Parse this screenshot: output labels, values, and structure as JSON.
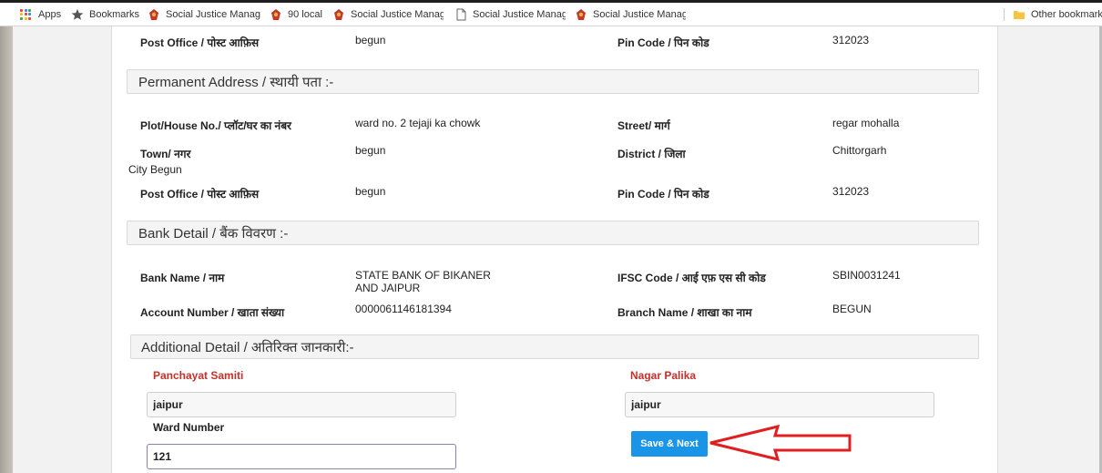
{
  "bookmarks": [
    {
      "label": "Apps",
      "icon": "apps-grid-icon"
    },
    {
      "label": "Bookmarks",
      "icon": "star-icon"
    },
    {
      "label": "Social Justice Manage",
      "icon": "emblem-icon"
    },
    {
      "label": "90 local",
      "icon": "emblem-icon"
    },
    {
      "label": "Social Justice Manage",
      "icon": "emblem-icon"
    },
    {
      "label": "Social Justice Manage",
      "icon": "page-icon"
    },
    {
      "label": "Social Justice Manage",
      "icon": "emblem-icon"
    },
    {
      "label": "Other bookmarks",
      "icon": "folder-icon"
    }
  ],
  "current_address": {
    "post_office_label": "Post Office / पोस्ट आफ़िस",
    "post_office": "begun",
    "pin_label": "Pin Code / पिन कोड",
    "pin": "312023"
  },
  "permanent_address": {
    "title": "Permanent Address / स्थायी पता :-",
    "house_label": "Plot/House No./ प्लॉट/घर का नंबर",
    "house": "ward no. 2 tejaji ka chowk",
    "street_label": "Street/ मार्ग",
    "street": "regar mohalla",
    "town_label": "Town/ नगर",
    "town": "begun",
    "district_label": "District / जिला",
    "district": "Chittorgarh",
    "city_note": "City Begun",
    "post_office_label": "Post Office / पोस्ट आफ़िस",
    "post_office": "begun",
    "pin_label": "Pin Code / पिन कोड",
    "pin": "312023"
  },
  "bank_detail": {
    "title": "Bank Detail / बैंक विवरण :-",
    "bank_name_label": "Bank Name / नाम",
    "bank_name_line1": "STATE BANK OF BIKANER",
    "bank_name_line2": "AND JAIPUR",
    "ifsc_label": "IFSC Code / आई एफ़ एस सी कोड",
    "ifsc": "SBIN0031241",
    "account_label": "Account Number / खाता संख्या",
    "account": "0000061146181394",
    "branch_label": "Branch Name / शाखा का नाम",
    "branch": "BEGUN"
  },
  "additional_detail": {
    "title": "Additional Detail / अतिरिक्त जानकारी:-",
    "panchayat_label": "Panchayat Samiti",
    "panchayat_value": "jaipur",
    "nagar_label": "Nagar Palika",
    "nagar_value": "jaipur",
    "ward_label": "Ward Number",
    "ward_value": "121",
    "save_label": "Save & Next"
  },
  "colors": {
    "button": "#1a94e6",
    "required_label": "#c9302c",
    "arrow": "#e02020"
  }
}
